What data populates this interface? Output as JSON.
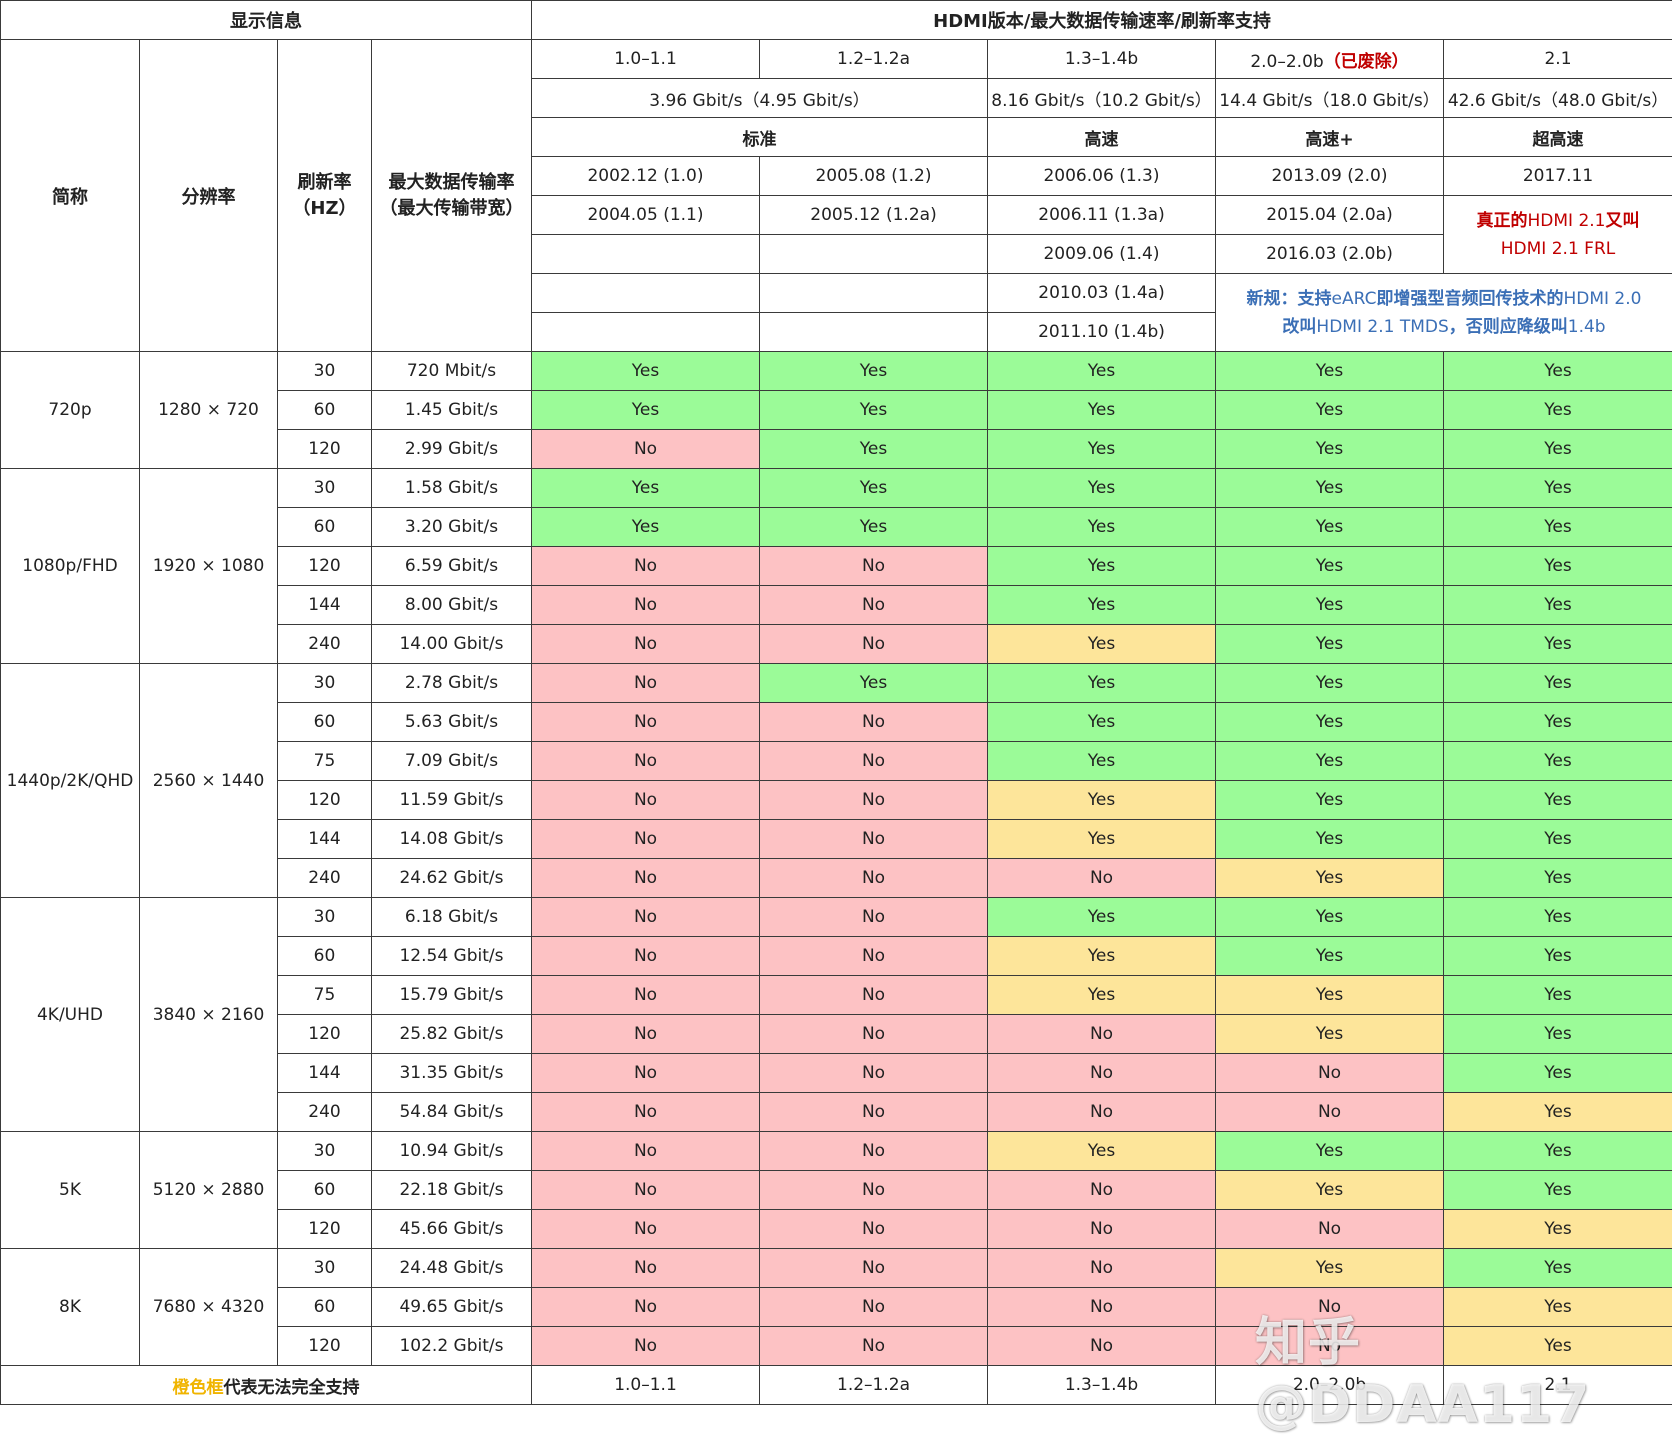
{
  "header": {
    "display_info": "显示信息",
    "hdmi_title": "HDMI版本/最大数据传输速率/刷新率支持",
    "col_name": "简称",
    "col_resolution": "分辨率",
    "col_refresh_l1": "刷新率",
    "col_refresh_l2": "（HZ）",
    "col_rate_l1": "最大数据传输率",
    "col_rate_l2": "（最大传输带宽）"
  },
  "versions": {
    "v1": "1.0–1.1",
    "v2": "1.2–1.2a",
    "v3": "1.3–1.4b",
    "v4_prefix": "2.0–2.0b",
    "v4_suffix": "（已废除）",
    "v5": "2.1"
  },
  "bandwidth": {
    "b12": "3.96 Gbit/s（4.95 Gbit/s）",
    "b3": "8.16 Gbit/s（10.2 Gbit/s）",
    "b4": "14.4 Gbit/s（18.0 Gbit/s）",
    "b5": "42.6 Gbit/s（48.0 Gbit/s）"
  },
  "tiers": {
    "t12": "标准",
    "t3": "高速",
    "t4": "高速+",
    "t5": "超高速"
  },
  "dates": {
    "v1": [
      "2002.12 (1.0)",
      "2004.05 (1.1)"
    ],
    "v2": [
      "2005.08 (1.2)",
      "2005.12 (1.2a)"
    ],
    "v3": [
      "2006.06 (1.3)",
      "2006.11 (1.3a)",
      "2009.06 (1.4)",
      "2010.03 (1.4a)",
      "2011.10 (1.4b)"
    ],
    "v4": [
      "2013.09 (2.0)",
      "2015.04 (2.0a)",
      "2016.03 (2.0b)"
    ],
    "v5": [
      "2017.11"
    ]
  },
  "notes": {
    "hdmi21_red": "真正的",
    "hdmi21_mid": "HDMI 2.1",
    "hdmi21_red2": "又叫",
    "hdmi21_frl": "HDMI 2.1 FRL",
    "earc_a": "新规：支持",
    "earc_b": "eARC",
    "earc_c": "即增强型音频回传技术的",
    "earc_d": "HDMI 2.0",
    "earc_e": "改叫",
    "earc_f": "HDMI 2.1 TMDS",
    "earc_g": "，否则应降级叫",
    "earc_h": "1.4b"
  },
  "groups": [
    {
      "name": "720p",
      "resolution": "1280 × 720",
      "rows": [
        {
          "hz": "30",
          "rate": "720 Mbit/s",
          "s": [
            "Yes",
            "Yes",
            "Yes",
            "Yes",
            "Yes"
          ],
          "c": [
            "y",
            "y",
            "y",
            "y",
            "y"
          ]
        },
        {
          "hz": "60",
          "rate": "1.45 Gbit/s",
          "s": [
            "Yes",
            "Yes",
            "Yes",
            "Yes",
            "Yes"
          ],
          "c": [
            "y",
            "y",
            "y",
            "y",
            "y"
          ]
        },
        {
          "hz": "120",
          "rate": "2.99 Gbit/s",
          "s": [
            "No",
            "Yes",
            "Yes",
            "Yes",
            "Yes"
          ],
          "c": [
            "n",
            "y",
            "y",
            "y",
            "y"
          ]
        }
      ]
    },
    {
      "name": "1080p/FHD",
      "resolution": "1920 × 1080",
      "rows": [
        {
          "hz": "30",
          "rate": "1.58 Gbit/s",
          "s": [
            "Yes",
            "Yes",
            "Yes",
            "Yes",
            "Yes"
          ],
          "c": [
            "y",
            "y",
            "y",
            "y",
            "y"
          ]
        },
        {
          "hz": "60",
          "rate": "3.20 Gbit/s",
          "s": [
            "Yes",
            "Yes",
            "Yes",
            "Yes",
            "Yes"
          ],
          "c": [
            "y",
            "y",
            "y",
            "y",
            "y"
          ]
        },
        {
          "hz": "120",
          "rate": "6.59 Gbit/s",
          "s": [
            "No",
            "No",
            "Yes",
            "Yes",
            "Yes"
          ],
          "c": [
            "n",
            "n",
            "y",
            "y",
            "y"
          ]
        },
        {
          "hz": "144",
          "rate": "8.00 Gbit/s",
          "s": [
            "No",
            "No",
            "Yes",
            "Yes",
            "Yes"
          ],
          "c": [
            "n",
            "n",
            "y",
            "y",
            "y"
          ]
        },
        {
          "hz": "240",
          "rate": "14.00 Gbit/s",
          "s": [
            "No",
            "No",
            "Yes",
            "Yes",
            "Yes"
          ],
          "c": [
            "n",
            "n",
            "o",
            "y",
            "y"
          ]
        }
      ]
    },
    {
      "name": "1440p/2K/QHD",
      "resolution": "2560 × 1440",
      "rows": [
        {
          "hz": "30",
          "rate": "2.78 Gbit/s",
          "s": [
            "No",
            "Yes",
            "Yes",
            "Yes",
            "Yes"
          ],
          "c": [
            "n",
            "y",
            "y",
            "y",
            "y"
          ]
        },
        {
          "hz": "60",
          "rate": "5.63 Gbit/s",
          "s": [
            "No",
            "No",
            "Yes",
            "Yes",
            "Yes"
          ],
          "c": [
            "n",
            "n",
            "y",
            "y",
            "y"
          ]
        },
        {
          "hz": "75",
          "rate": "7.09 Gbit/s",
          "s": [
            "No",
            "No",
            "Yes",
            "Yes",
            "Yes"
          ],
          "c": [
            "n",
            "n",
            "y",
            "y",
            "y"
          ]
        },
        {
          "hz": "120",
          "rate": "11.59 Gbit/s",
          "s": [
            "No",
            "No",
            "Yes",
            "Yes",
            "Yes"
          ],
          "c": [
            "n",
            "n",
            "o",
            "y",
            "y"
          ]
        },
        {
          "hz": "144",
          "rate": "14.08 Gbit/s",
          "s": [
            "No",
            "No",
            "Yes",
            "Yes",
            "Yes"
          ],
          "c": [
            "n",
            "n",
            "o",
            "y",
            "y"
          ]
        },
        {
          "hz": "240",
          "rate": "24.62 Gbit/s",
          "s": [
            "No",
            "No",
            "No",
            "Yes",
            "Yes"
          ],
          "c": [
            "n",
            "n",
            "n",
            "o",
            "y"
          ]
        }
      ]
    },
    {
      "name": "4K/UHD",
      "resolution": "3840 × 2160",
      "rows": [
        {
          "hz": "30",
          "rate": "6.18 Gbit/s",
          "s": [
            "No",
            "No",
            "Yes",
            "Yes",
            "Yes"
          ],
          "c": [
            "n",
            "n",
            "y",
            "y",
            "y"
          ]
        },
        {
          "hz": "60",
          "rate": "12.54 Gbit/s",
          "s": [
            "No",
            "No",
            "Yes",
            "Yes",
            "Yes"
          ],
          "c": [
            "n",
            "n",
            "o",
            "y",
            "y"
          ]
        },
        {
          "hz": "75",
          "rate": "15.79 Gbit/s",
          "s": [
            "No",
            "No",
            "Yes",
            "Yes",
            "Yes"
          ],
          "c": [
            "n",
            "n",
            "o",
            "o",
            "y"
          ]
        },
        {
          "hz": "120",
          "rate": "25.82 Gbit/s",
          "s": [
            "No",
            "No",
            "No",
            "Yes",
            "Yes"
          ],
          "c": [
            "n",
            "n",
            "n",
            "o",
            "y"
          ]
        },
        {
          "hz": "144",
          "rate": "31.35 Gbit/s",
          "s": [
            "No",
            "No",
            "No",
            "No",
            "Yes"
          ],
          "c": [
            "n",
            "n",
            "n",
            "n",
            "y"
          ]
        },
        {
          "hz": "240",
          "rate": "54.84 Gbit/s",
          "s": [
            "No",
            "No",
            "No",
            "No",
            "Yes"
          ],
          "c": [
            "n",
            "n",
            "n",
            "n",
            "o"
          ]
        }
      ]
    },
    {
      "name": "5K",
      "resolution": "5120 × 2880",
      "rows": [
        {
          "hz": "30",
          "rate": "10.94 Gbit/s",
          "s": [
            "No",
            "No",
            "Yes",
            "Yes",
            "Yes"
          ],
          "c": [
            "n",
            "n",
            "o",
            "y",
            "y"
          ]
        },
        {
          "hz": "60",
          "rate": "22.18 Gbit/s",
          "s": [
            "No",
            "No",
            "No",
            "Yes",
            "Yes"
          ],
          "c": [
            "n",
            "n",
            "n",
            "o",
            "y"
          ]
        },
        {
          "hz": "120",
          "rate": "45.66 Gbit/s",
          "s": [
            "No",
            "No",
            "No",
            "No",
            "Yes"
          ],
          "c": [
            "n",
            "n",
            "n",
            "n",
            "o"
          ]
        }
      ]
    },
    {
      "name": "8K",
      "resolution": "7680 × 4320",
      "rows": [
        {
          "hz": "30",
          "rate": "24.48 Gbit/s",
          "s": [
            "No",
            "No",
            "No",
            "Yes",
            "Yes"
          ],
          "c": [
            "n",
            "n",
            "n",
            "o",
            "y"
          ]
        },
        {
          "hz": "60",
          "rate": "49.65 Gbit/s",
          "s": [
            "No",
            "No",
            "No",
            "No",
            "Yes"
          ],
          "c": [
            "n",
            "n",
            "n",
            "n",
            "o"
          ]
        },
        {
          "hz": "120",
          "rate": "102.2 Gbit/s",
          "s": [
            "No",
            "No",
            "No",
            "No",
            "Yes"
          ],
          "c": [
            "n",
            "n",
            "n",
            "n",
            "o"
          ]
        }
      ]
    }
  ],
  "footer": {
    "legend_orange": "橙色框",
    "legend_rest": "代表无法完全支持",
    "v1": "1.0–1.1",
    "v2": "1.2–1.2a",
    "v3": "1.3–1.4b",
    "v4": "2.0–2.0b",
    "v5": "2.1"
  },
  "colors": {
    "yes": "#9bfb98",
    "no": "#fdc2c4",
    "partial": "#fde59a",
    "legend_orange": "#f0b400"
  },
  "watermark": "知乎 @DDAA117"
}
